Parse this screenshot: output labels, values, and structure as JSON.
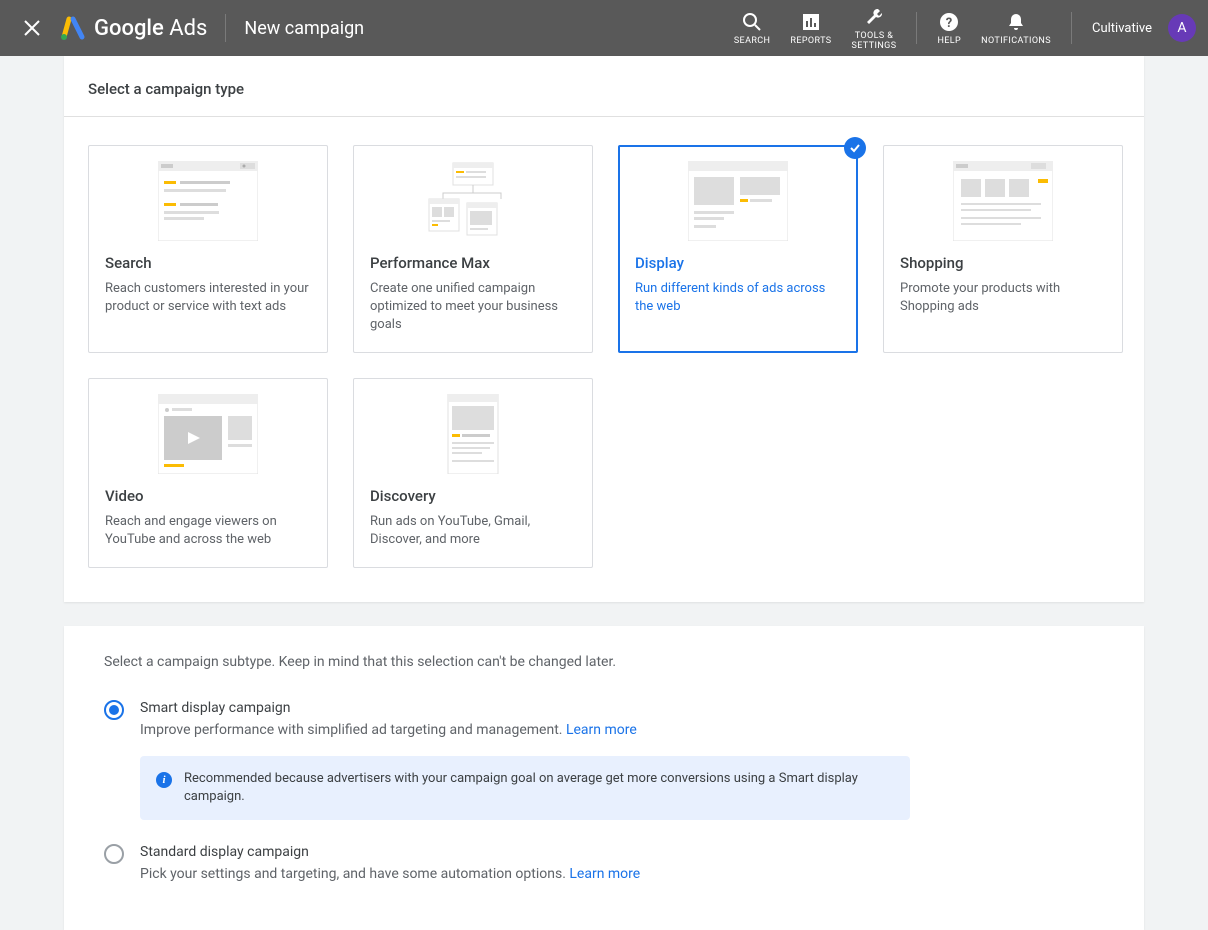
{
  "header": {
    "logo_text_google": "Google",
    "logo_text_ads": "Ads",
    "page_title": "New campaign",
    "tools": {
      "search": "SEARCH",
      "reports": "REPORTS",
      "tools": "TOOLS & SETTINGS",
      "help": "HELP",
      "notifications": "NOTIFICATIONS"
    },
    "account_name": "Cultivative",
    "avatar_letter": "A"
  },
  "panel1": {
    "title": "Select a campaign type",
    "cards": [
      {
        "title": "Search",
        "desc": "Reach customers interested in your product or service with text ads"
      },
      {
        "title": "Performance Max",
        "desc": "Create one unified campaign optimized to meet your business goals"
      },
      {
        "title": "Display",
        "desc": "Run different kinds of ads across the web"
      },
      {
        "title": "Shopping",
        "desc": "Promote your products with Shopping ads"
      },
      {
        "title": "Video",
        "desc": "Reach and engage viewers on YouTube and across the web"
      },
      {
        "title": "Discovery",
        "desc": "Run ads on YouTube, Gmail, Discover, and more"
      }
    ]
  },
  "panel2": {
    "intro": "Select a campaign subtype. Keep in mind that this selection can't be changed later.",
    "options": [
      {
        "title": "Smart display campaign",
        "desc": "Improve performance with simplified ad targeting and management. ",
        "learn_more": "Learn more",
        "info": "Recommended because advertisers with your campaign goal on average get more conversions using a Smart display campaign."
      },
      {
        "title": "Standard display campaign",
        "desc": "Pick your settings and targeting, and have some automation options. ",
        "learn_more": "Learn more"
      }
    ]
  }
}
